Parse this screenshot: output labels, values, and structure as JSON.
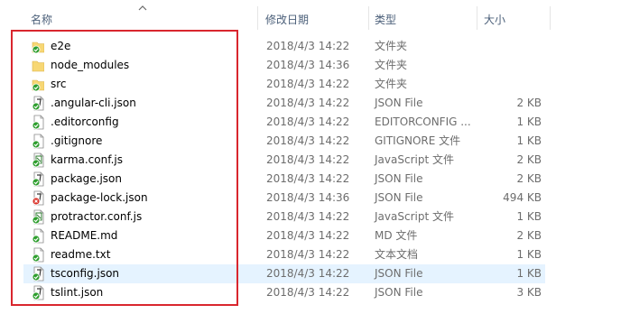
{
  "columns": {
    "name": "名称",
    "date": "修改日期",
    "type": "类型",
    "size": "大小"
  },
  "sort_icon": "chevron-up-icon",
  "colors": {
    "folder": "#f7d774",
    "check": "#2e9e2e",
    "error": "#d9342b",
    "highlight_box": "#d9262e",
    "hover_row": "#e5f3ff"
  },
  "files": [
    {
      "name": "e2e",
      "date": "2018/4/3 14:22",
      "type": "文件夹",
      "size": "",
      "icon": "folder-synced-icon"
    },
    {
      "name": "node_modules",
      "date": "2018/4/3 14:36",
      "type": "文件夹",
      "size": "",
      "icon": "folder-icon"
    },
    {
      "name": "src",
      "date": "2018/4/3 14:22",
      "type": "文件夹",
      "size": "",
      "icon": "folder-synced-icon"
    },
    {
      "name": ".angular-cli.json",
      "date": "2018/4/3 14:22",
      "type": "JSON File",
      "size": "2 KB",
      "icon": "json-file-synced-icon"
    },
    {
      "name": ".editorconfig",
      "date": "2018/4/3 14:22",
      "type": "EDITORCONFIG ...",
      "size": "1 KB",
      "icon": "file-synced-icon"
    },
    {
      "name": ".gitignore",
      "date": "2018/4/3 14:22",
      "type": "GITIGNORE 文件",
      "size": "1 KB",
      "icon": "file-synced-icon"
    },
    {
      "name": "karma.conf.js",
      "date": "2018/4/3 14:22",
      "type": "JavaScript 文件",
      "size": "2 KB",
      "icon": "js-file-synced-icon"
    },
    {
      "name": "package.json",
      "date": "2018/4/3 14:22",
      "type": "JSON File",
      "size": "2 KB",
      "icon": "json-file-synced-icon"
    },
    {
      "name": "package-lock.json",
      "date": "2018/4/3 14:36",
      "type": "JSON File",
      "size": "494 KB",
      "icon": "json-file-modified-icon"
    },
    {
      "name": "protractor.conf.js",
      "date": "2018/4/3 14:22",
      "type": "JavaScript 文件",
      "size": "1 KB",
      "icon": "js-file-synced-icon"
    },
    {
      "name": "README.md",
      "date": "2018/4/3 14:22",
      "type": "MD 文件",
      "size": "2 KB",
      "icon": "file-synced-icon"
    },
    {
      "name": "readme.txt",
      "date": "2018/4/3 14:22",
      "type": "文本文档",
      "size": "1 KB",
      "icon": "file-synced-icon"
    },
    {
      "name": "tsconfig.json",
      "date": "2018/4/3 14:22",
      "type": "JSON File",
      "size": "1 KB",
      "icon": "json-file-synced-icon",
      "hover": true
    },
    {
      "name": "tslint.json",
      "date": "2018/4/3 14:22",
      "type": "JSON File",
      "size": "3 KB",
      "icon": "json-file-synced-icon"
    }
  ]
}
